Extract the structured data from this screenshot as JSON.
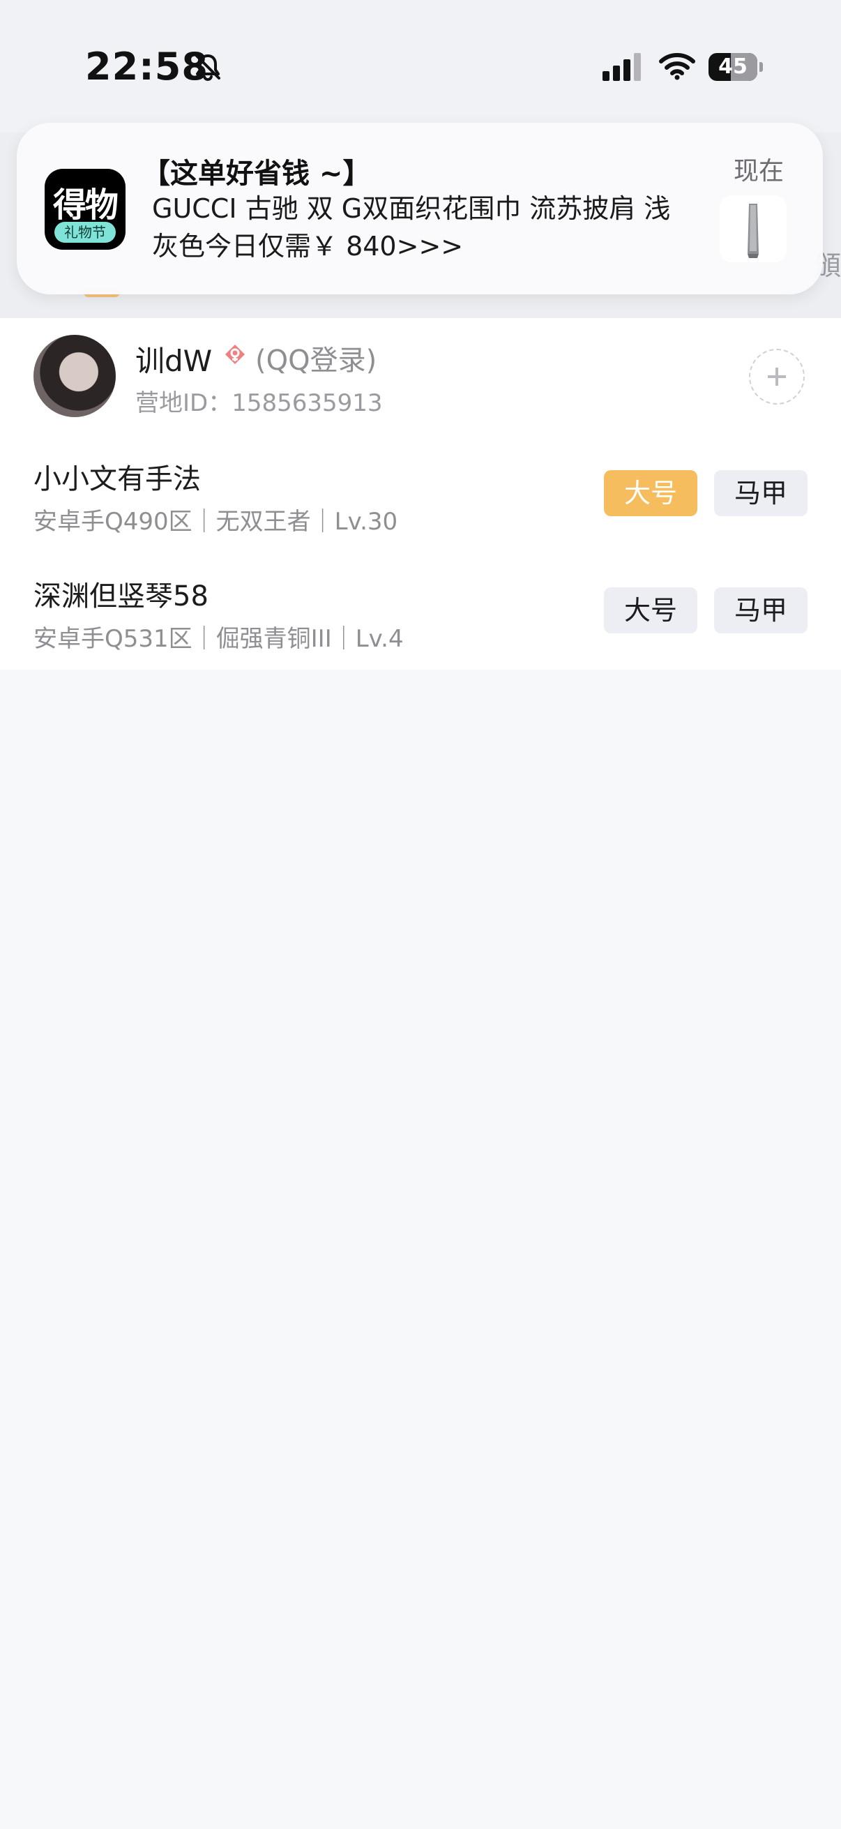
{
  "status_bar": {
    "time": "22:58",
    "battery": "45",
    "battery_level": 0.45,
    "icons": [
      "bell-muted-icon",
      "signal-icon",
      "wifi-icon",
      "battery-icon"
    ]
  },
  "background": {
    "partial_right_text": "頒"
  },
  "notification": {
    "app_icon_text": "得物",
    "app_icon_tag": "礼物节",
    "title": "【这单好省钱 ~】",
    "body": "GUCCI 古驰 双 G双面织花围巾 流苏披肩 浅灰色今日仅需￥ 840>>>",
    "time": "现在",
    "thumbnail_icon": "scarf-thumbnail"
  },
  "account": {
    "name": "训dW",
    "login_type": "(QQ登录)",
    "camp_id": "营地ID：1585635913",
    "gender_icon": "female-icon",
    "add_icon": "plus-icon"
  },
  "roles": [
    {
      "name": "小小文有手法",
      "meta": "安卓手Q490区｜无双王者｜Lv.30",
      "main_tag": "大号",
      "alt_tag": "马甲",
      "main_active": true
    },
    {
      "name": "深渊但竖琴58",
      "meta": "安卓手Q531区｜倔强青铜III｜Lv.4",
      "main_tag": "大号",
      "alt_tag": "马甲",
      "main_active": false
    }
  ],
  "colors": {
    "accent": "#f5bd5d",
    "tag_bg": "#eceef4",
    "page_bg": "#f7f8fa"
  }
}
